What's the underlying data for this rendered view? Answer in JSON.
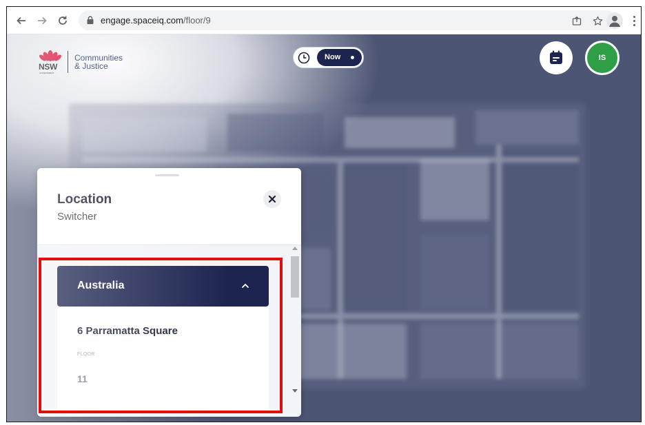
{
  "browser": {
    "url_domain": "engage.spaceiq.com",
    "url_path": "/floor/9",
    "back_icon": "arrow-left-icon",
    "forward_icon": "arrow-right-icon",
    "reload_icon": "reload-icon"
  },
  "logo": {
    "mark_text": "NSW",
    "mark_subtext": "GOVERNMENT",
    "dept_line1": "Communities",
    "dept_line2": "& Justice"
  },
  "time_toggle": {
    "label": "Now"
  },
  "user": {
    "initials": "IS",
    "avatar_color": "#2e9f47"
  },
  "panel": {
    "title": "Location",
    "subtitle": "Switcher",
    "country": "Australia",
    "building": "6 Parramatta Square",
    "floor_label": "FLOOR",
    "floor_value": "11"
  },
  "colors": {
    "primary": "#1d2450",
    "highlight": "#e10e0e"
  }
}
